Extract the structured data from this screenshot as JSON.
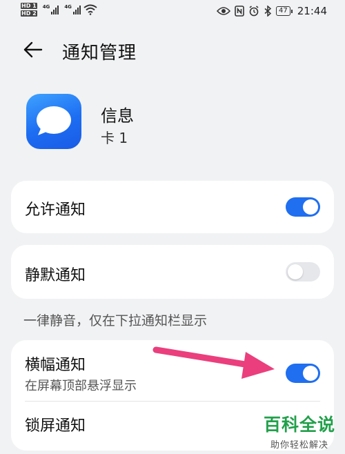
{
  "status_bar": {
    "hd1": "HD 1",
    "hd2": "HD 2",
    "net1": "4G",
    "net2": "4G",
    "battery": "47",
    "time": "21:44"
  },
  "header": {
    "title": "通知管理"
  },
  "app": {
    "name": "信息",
    "sub": "卡 1"
  },
  "settings": {
    "allow": {
      "label": "允许通知",
      "enabled": true
    },
    "silent": {
      "label": "静默通知",
      "enabled": false
    },
    "silent_hint": "一律静音，仅在下拉通知栏显示",
    "banner": {
      "label": "横幅通知",
      "sub": "在屏幕顶部悬浮显示",
      "enabled": true
    },
    "lockscreen": {
      "label": "锁屏通知"
    }
  },
  "colors": {
    "accent": "#1f6ff0",
    "annotation_arrow": "#ea3f7c",
    "watermark": "#21a04a"
  },
  "watermark": {
    "title": "百科全说",
    "sub": "助你轻松解决"
  }
}
